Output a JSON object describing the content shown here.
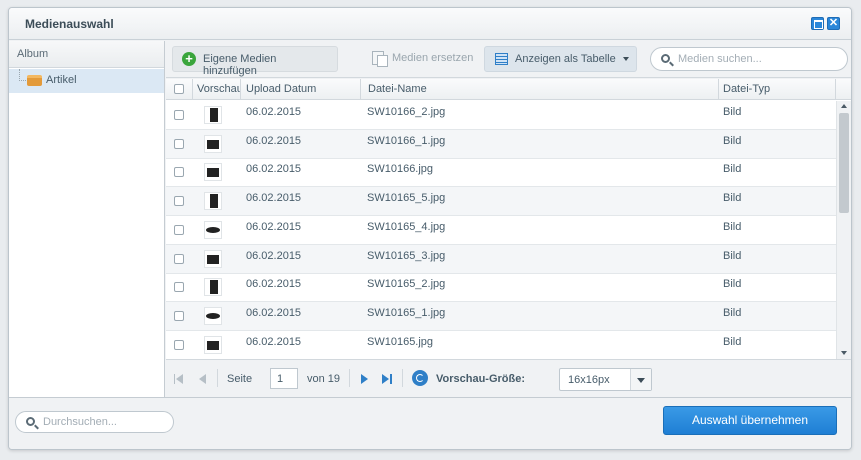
{
  "window": {
    "title": "Medienauswahl",
    "close_label": "✕"
  },
  "album": {
    "header": "Album",
    "items": [
      {
        "label": "Artikel"
      }
    ]
  },
  "toolbar": {
    "add_label": "Eigene Medien hinzufügen",
    "replace_label": "Medien ersetzen",
    "view_label": "Anzeigen als Tabelle",
    "search_placeholder": "Medien suchen..."
  },
  "grid": {
    "columns": {
      "preview": "Vorschau",
      "upload_date": "Upload Datum",
      "file_name": "Datei-Name",
      "file_type": "Datei-Typ"
    },
    "rows": [
      {
        "thumb": "portrait",
        "date": "06.02.2015",
        "name": "SW10166_2.jpg",
        "type": "Bild"
      },
      {
        "thumb": "land",
        "date": "06.02.2015",
        "name": "SW10166_1.jpg",
        "type": "Bild"
      },
      {
        "thumb": "land",
        "date": "06.02.2015",
        "name": "SW10166.jpg",
        "type": "Bild"
      },
      {
        "thumb": "portrait",
        "date": "06.02.2015",
        "name": "SW10165_5.jpg",
        "type": "Bild"
      },
      {
        "thumb": "oval",
        "date": "06.02.2015",
        "name": "SW10165_4.jpg",
        "type": "Bild"
      },
      {
        "thumb": "land",
        "date": "06.02.2015",
        "name": "SW10165_3.jpg",
        "type": "Bild"
      },
      {
        "thumb": "portrait",
        "date": "06.02.2015",
        "name": "SW10165_2.jpg",
        "type": "Bild"
      },
      {
        "thumb": "oval",
        "date": "06.02.2015",
        "name": "SW10165_1.jpg",
        "type": "Bild"
      },
      {
        "thumb": "land",
        "date": "06.02.2015",
        "name": "SW10165.jpg",
        "type": "Bild"
      }
    ]
  },
  "pager": {
    "page_label": "Seite",
    "current_page": "1",
    "of_label": "von 19",
    "preview_size_label": "Vorschau-Größe:",
    "preview_size_value": "16x16px"
  },
  "footer": {
    "search_placeholder": "Durchsuchen...",
    "apply_label": "Auswahl übernehmen"
  }
}
